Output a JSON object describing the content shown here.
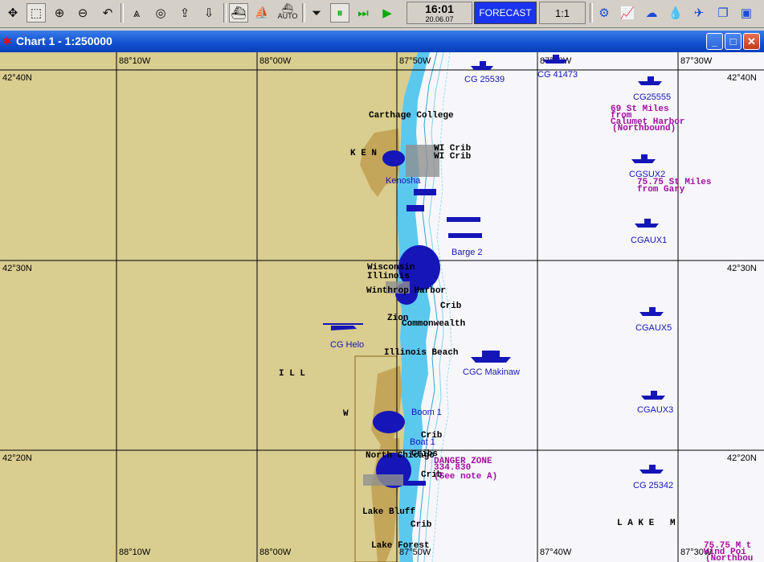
{
  "toolbar": {
    "clock_time": "16:01",
    "clock_date": "20.06.07",
    "forecast_label": "FORECAST",
    "scale_label": "1:1",
    "auto_label": "AUTO"
  },
  "window": {
    "title": "Chart 1 - 1:250000"
  },
  "map": {
    "lon_labels": [
      "88°10W",
      "88°00W",
      "87°50W",
      "87°40W",
      "87°30W"
    ],
    "lat_labels": [
      "42°40N",
      "42°30N",
      "42°20N"
    ],
    "vessels": [
      "CG 25539",
      "CG 41473",
      "CG25555",
      "CGSUX2",
      "CGAUX1",
      "CGAUX5",
      "CGAUX3",
      "CG 25342",
      "CGC Makinaw",
      "CG Helo",
      "Barge 2",
      "Boom 1",
      "Boat 1"
    ],
    "places": [
      "Carthage College",
      "K E N",
      "WI Crib",
      "WI Crib",
      "Kenosha",
      "Lake Forest",
      "Illinois Beach",
      "Zion",
      "Commonwealth",
      "Crib",
      "Crib",
      "Cribs",
      "Lake Bluff",
      "Winthrop Harbor",
      "Wisconsin",
      "Illinois",
      "I L L",
      "W",
      "North Chicago",
      "Crib",
      "Crib"
    ],
    "notes": {
      "calumet_1": "69 St Miles",
      "calumet_2": "from",
      "calumet_3": "Calumet Harbor",
      "calumet_4": "(Northbound)",
      "gary_1": "75.75 St Miles",
      "gary_2": "from Gary",
      "danger_1": "DANGER ZONE",
      "danger_2": "334.830",
      "danger_3": "(See note A)",
      "lake_label": "L A K E   M",
      "bottom_right_1": "75.75 M t",
      "bottom_right_2": "Wind Poi",
      "bottom_right_3": "(Northbou"
    }
  },
  "colors": {
    "land": "#d9cd8f",
    "land_dark": "#c4a65a",
    "water": "#f7f7fb",
    "shallow": "#5bc8ee",
    "vessel": "#1515b8",
    "magenta": "#a0109e",
    "grid": "#000000"
  }
}
